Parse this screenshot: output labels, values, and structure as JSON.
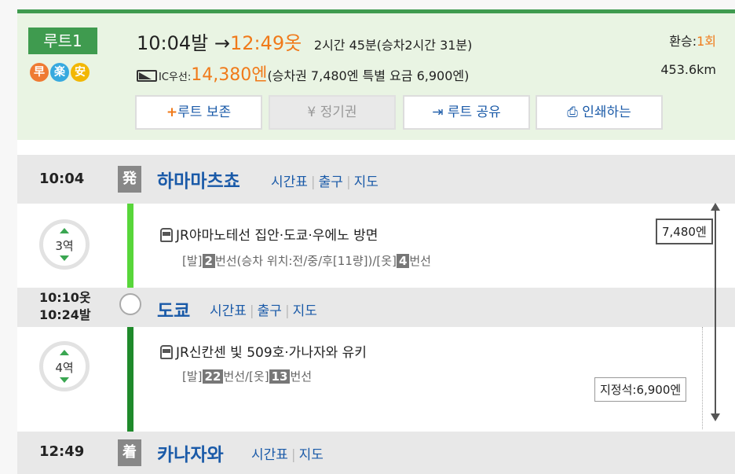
{
  "route": {
    "badge": "루트1",
    "icons": [
      "早",
      "楽",
      "安"
    ],
    "depart_time": "10:04발",
    "arrow": "→",
    "arrive_time": "12:49옷",
    "duration": "2시간 45분(승차2시간 31분)",
    "transfer_label": "환승:",
    "transfer_count": "1회",
    "ic_label": "IC우선:",
    "fare": "14,380엔",
    "fare_detail": "(승차권 7,480엔 특별 요금 6,900엔)",
    "distance": "453.6km"
  },
  "buttons": {
    "save": "루트 보존",
    "save_icon": "+",
    "pass": "정기권",
    "pass_icon": "¥",
    "share": "루트 공유",
    "share_icon": "⇥",
    "print": "인쇄하는",
    "print_icon": "⎙"
  },
  "stations": [
    {
      "time": "10:04",
      "icon": "発",
      "name": "하마마츠쵸",
      "links": [
        "시간표",
        "출구",
        "지도"
      ]
    },
    {
      "time_arrive": "10:10옷",
      "time_depart": "10:24발",
      "name": "도쿄",
      "links": [
        "시간표",
        "출구",
        "지도"
      ]
    },
    {
      "time": "12:49",
      "icon": "着",
      "name": "카나자와",
      "links": [
        "시간표",
        "지도"
      ]
    }
  ],
  "segments": [
    {
      "stops": "3역",
      "train": "JR야마노테선 집안·도쿄·우에노 방면",
      "platform_prefix": "[발]",
      "platform_dep": "2",
      "platform_mid": "번선(승차 위치:전/중/후[11량])/[옷]",
      "platform_arr": "4",
      "platform_suffix": "번선",
      "line_color": "#58d63a"
    },
    {
      "stops": "4역",
      "train": "JR신칸센 빛 509호·가나자와 유키",
      "platform_prefix": "[발]",
      "platform_dep": "22",
      "platform_mid": "번선/[옷]",
      "platform_arr": "13",
      "platform_suffix": "번선",
      "line_color": "#1f8a2b"
    }
  ],
  "fares": {
    "ticket": "7,480엔",
    "reserved": "지정석:6,900엔"
  }
}
